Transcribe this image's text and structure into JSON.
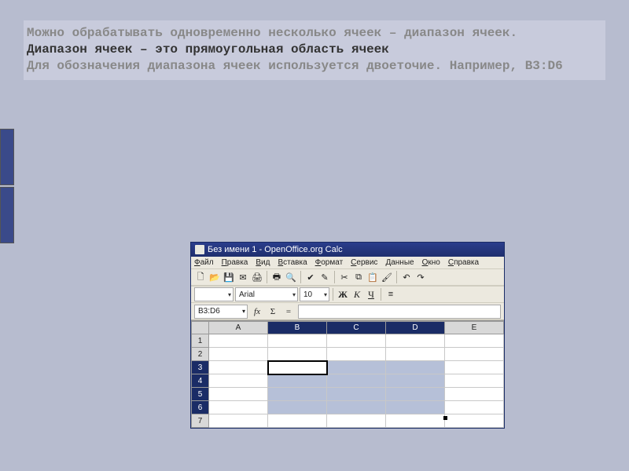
{
  "explain": {
    "p1": "Можно обрабатывать одновременно несколько ячеек – диапазон ячеек.",
    "p2": "Диапазон ячеек – это прямоугольная область ячеек",
    "p3": "Для обозначения диапазона ячеек используется двоеточие. Например, B3:D6"
  },
  "app": {
    "title": "Без имени 1 - OpenOffice.org Calc",
    "menu": {
      "file": "Файл",
      "edit": "Правка",
      "view": "Вид",
      "insert": "Вставка",
      "format": "Формат",
      "tools": "Сервис",
      "data": "Данные",
      "window": "Окно",
      "help": "Справка"
    },
    "format_bar": {
      "style": "",
      "font": "Arial",
      "size": "10",
      "bold": "Ж",
      "italic": "К",
      "underline": "Ч"
    },
    "formula_bar": {
      "namebox": "B3:D6",
      "fx": "fx",
      "sigma": "Σ",
      "eq": "="
    },
    "sheet": {
      "cols": [
        "A",
        "B",
        "C",
        "D",
        "E"
      ],
      "rows": [
        "1",
        "2",
        "3",
        "4",
        "5",
        "6",
        "7"
      ],
      "selected_cols": [
        "B",
        "C",
        "D"
      ],
      "selected_rows": [
        "3",
        "4",
        "5",
        "6"
      ],
      "active_cell": "B3",
      "selection": "B3:D6"
    }
  }
}
